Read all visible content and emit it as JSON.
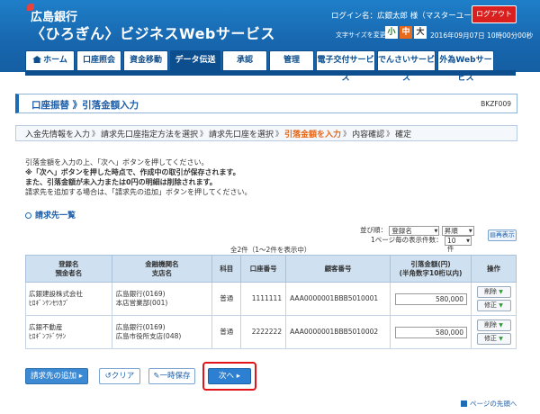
{
  "header": {
    "bank_name": "広島銀行",
    "service_name": "〈ひろぎん〉ビジネスWebサービス",
    "login_info": "ログイン名：広銀太郎 様（マスターユーザ）",
    "logout": "ログアウト",
    "font_size_label": "文字サイズを変更",
    "font_small": "小",
    "font_mid": "中",
    "font_large": "大",
    "datetime": "2016年09月07日 10時00分00秒"
  },
  "nav": {
    "home": "ホーム",
    "account_inquiry": "口座照会",
    "fund_transfer": "資金移動",
    "data_transfer": "データ伝送",
    "approval": "承認",
    "management": "管理",
    "electronic_delivery": "電子交付サービス",
    "densai": "でんさいサービス",
    "forex": "外為Webサービス"
  },
  "page": {
    "title": "口座振替 》引落金額入力",
    "page_id": "BKZF009"
  },
  "steps": [
    "入金先情報を入力",
    "請求先口座指定方法を選択",
    "請求先口座を選択",
    "引落金額を入力",
    "内容確認",
    "確定"
  ],
  "instructions": {
    "line1": "引落金額を入力の上、「次へ」ボタンを押してください。",
    "line2": "※「次へ」ボタンを押した時点で、作成中の取引が保存されます。",
    "line3": "また、引落金額が未入力または0円の明細は削除されます。",
    "line4": "請求先を追加する場合は、「請求先の追加」ボタンを押してください。"
  },
  "section": {
    "heading": "請求先一覧"
  },
  "sort": {
    "label": "並び順：",
    "field": "登録名",
    "order": "昇順",
    "per_page_label": "1ページ毎の表示件数：",
    "per_page": "10件",
    "redisplay": "再表示"
  },
  "total": "全2件（1〜2件を表示中）",
  "table": {
    "headers": {
      "name": "登録名",
      "name2": "預金者名",
      "bank": "金融機関名",
      "bank2": "支店名",
      "kind": "科目",
      "acct": "口座番号",
      "cust": "顧客番号",
      "amt": "引落金額(円)",
      "amt2": "(半角数字10桁以内)",
      "op": "操作"
    },
    "rows": [
      {
        "name": "広銀建設株式会社",
        "name_kana": "ﾋﾛｷﾞﾝｹﾝｾﾂｶﾌﾞ",
        "bank": "広島銀行(0169)",
        "branch": "本店営業部(001)",
        "kind": "普通",
        "acct": "1111111",
        "cust": "AAA0000001BBB5010001",
        "amount": "580,000",
        "delete": "削除",
        "edit": "修正"
      },
      {
        "name": "広銀不動産",
        "name_kana": "ﾋﾛｷﾞﾝﾌﾄﾞｳｻﾝ",
        "bank": "広島銀行(0169)",
        "branch": "広島市役所支店(048)",
        "kind": "普通",
        "acct": "2222222",
        "cust": "AAA0000001BBB5010002",
        "amount": "580,000",
        "delete": "削除",
        "edit": "修正"
      }
    ]
  },
  "buttons": {
    "add": "請求先の追加",
    "clear": "クリア",
    "save": "一時保存",
    "next": "次へ"
  },
  "page_top": "ページの先頭へ"
}
